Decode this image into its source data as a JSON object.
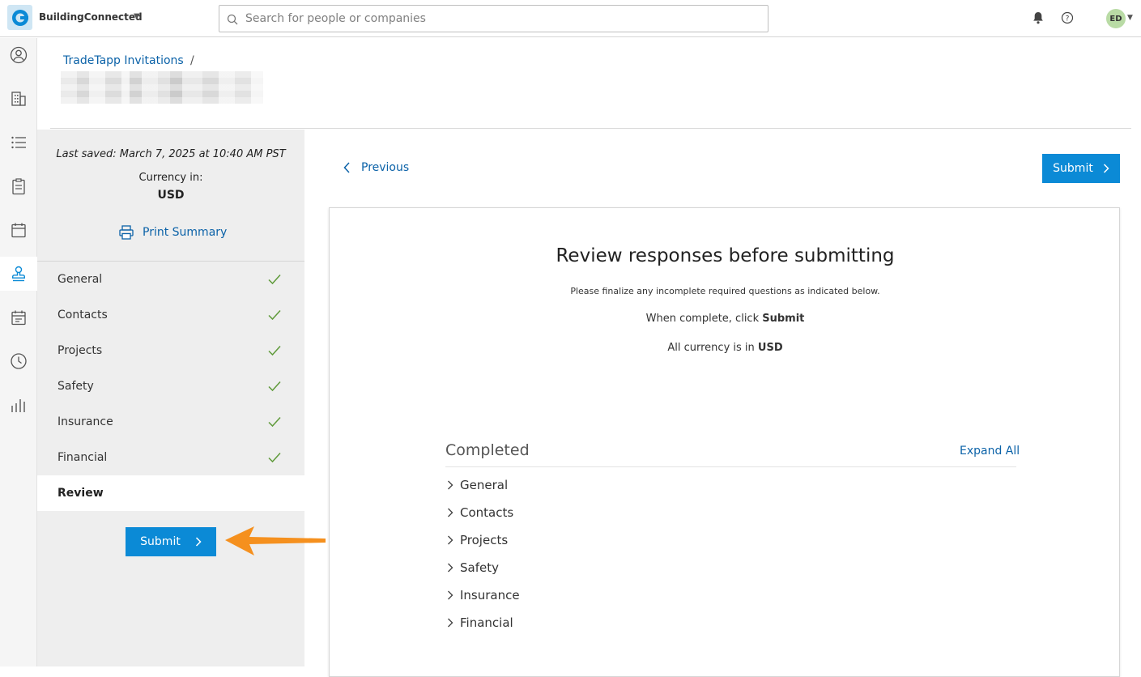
{
  "app": {
    "name": "BuildingConnected",
    "search_placeholder": "Search for people or companies",
    "user_initials": "ED"
  },
  "breadcrumb": {
    "parent": "TradeTapp Invitations",
    "separator": "/"
  },
  "sidebar": {
    "last_saved": "Last saved: March 7, 2025 at 10:40 AM PST",
    "currency_label": "Currency in:",
    "currency_value": "USD",
    "print_label": "Print Summary",
    "items": [
      {
        "label": "General",
        "complete": true
      },
      {
        "label": "Contacts",
        "complete": true
      },
      {
        "label": "Projects",
        "complete": true
      },
      {
        "label": "Safety",
        "complete": true
      },
      {
        "label": "Insurance",
        "complete": true
      },
      {
        "label": "Financial",
        "complete": true
      },
      {
        "label": "Review",
        "complete": false
      }
    ],
    "submit_label": "Submit"
  },
  "main": {
    "previous_label": "Previous",
    "submit_label": "Submit",
    "title": "Review responses before submitting",
    "subtitle": "Please finalize any incomplete required questions as indicated below.",
    "instruction_prefix": "When complete, click ",
    "instruction_bold": "Submit",
    "currency_prefix": "All currency is in ",
    "currency_bold": "USD",
    "completed_heading": "Completed",
    "expand_all": "Expand All",
    "sections": [
      "General",
      "Contacts",
      "Projects",
      "Safety",
      "Insurance",
      "Financial"
    ]
  },
  "colors": {
    "accent": "#0b8ad6",
    "link": "#0b62a8",
    "check": "#5f9a3a",
    "annotation_arrow": "#f5901e"
  }
}
